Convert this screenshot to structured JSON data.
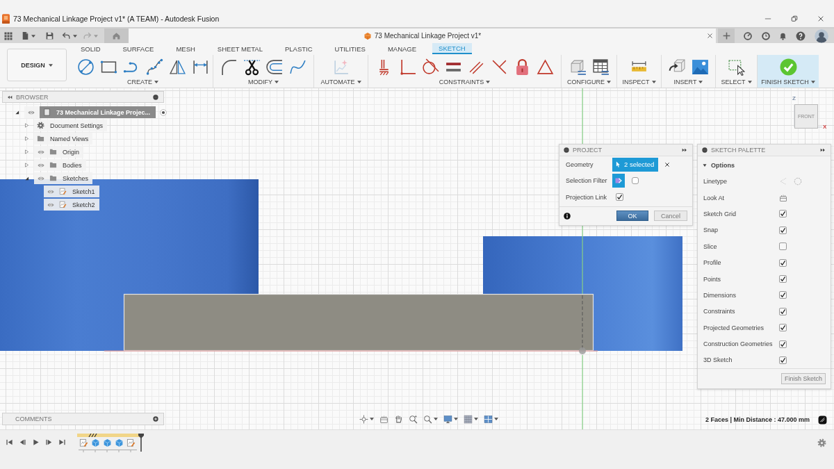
{
  "window": {
    "title": "73 Mechanical Linkage Project v1* (A TEAM) - Autodesk Fusion"
  },
  "quick_access": {
    "undo": {
      "disabled": false
    },
    "redo": {
      "disabled": true
    }
  },
  "document_tab": {
    "title": "73 Mechanical Linkage Project v1*"
  },
  "ribbon": {
    "workspace": "DESIGN",
    "tabs": [
      {
        "label": "SOLID",
        "selected": false
      },
      {
        "label": "SURFACE",
        "selected": false
      },
      {
        "label": "MESH",
        "selected": false
      },
      {
        "label": "SHEET METAL",
        "selected": false
      },
      {
        "label": "PLASTIC",
        "selected": false
      },
      {
        "label": "UTILITIES",
        "selected": false
      },
      {
        "label": "MANAGE",
        "selected": false
      },
      {
        "label": "SKETCH",
        "selected": true
      }
    ],
    "groups": [
      {
        "label": "CREATE",
        "highlighted": false
      },
      {
        "label": "MODIFY",
        "highlighted": false
      },
      {
        "label": "AUTOMATE",
        "highlighted": false
      },
      {
        "label": "CONSTRAINTS",
        "highlighted": false
      },
      {
        "label": "CONFIGURE",
        "highlighted": false
      },
      {
        "label": "INSPECT",
        "highlighted": false
      },
      {
        "label": "INSERT",
        "highlighted": false
      },
      {
        "label": "SELECT",
        "highlighted": false
      },
      {
        "label": "FINISH SKETCH",
        "highlighted": true
      }
    ]
  },
  "browser": {
    "title": "BROWSER",
    "tree": [
      {
        "label": "73 Mechanical Linkage Projec...",
        "kind": "document",
        "eye": true,
        "expanded": true,
        "children": [
          {
            "label": "Document Settings",
            "kind": "settings",
            "eye": false,
            "expanded": false
          },
          {
            "label": "Named Views",
            "kind": "folder",
            "eye": false,
            "expanded": false
          },
          {
            "label": "Origin",
            "kind": "folder",
            "eye": true,
            "expanded": false
          },
          {
            "label": "Bodies",
            "kind": "folder",
            "eye": true,
            "expanded": false
          },
          {
            "label": "Sketches",
            "kind": "folder",
            "eye": true,
            "expanded": true,
            "children": [
              {
                "label": "Sketch1",
                "kind": "sketch",
                "eye": true
              },
              {
                "label": "Sketch2",
                "kind": "sketch",
                "eye": true
              }
            ]
          }
        ]
      }
    ]
  },
  "view_cube": {
    "face": "FRONT",
    "axes": [
      "Z",
      "X"
    ]
  },
  "project_dialog": {
    "title": "PROJECT",
    "geometry": {
      "label": "Geometry",
      "value": "2 selected",
      "selected": true
    },
    "selection_filter": {
      "label": "Selection Filter",
      "options": [
        {
          "selected": true
        },
        {
          "selected": false
        }
      ]
    },
    "projection_link": {
      "label": "Projection Link",
      "checked": true
    },
    "buttons": [
      {
        "label": "OK",
        "kind": "primary"
      },
      {
        "label": "Cancel",
        "kind": "secondary"
      }
    ]
  },
  "sketch_palette": {
    "title": "SKETCH PALETTE",
    "section": {
      "label": "Options",
      "expanded": true
    },
    "options": [
      {
        "label": "Linetype",
        "kind": "linetype"
      },
      {
        "label": "Look At",
        "kind": "look_at"
      },
      {
        "label": "Sketch Grid",
        "kind": "checkbox",
        "checked": true
      },
      {
        "label": "Snap",
        "kind": "checkbox",
        "checked": true
      },
      {
        "label": "Slice",
        "kind": "checkbox",
        "checked": false
      },
      {
        "label": "Profile",
        "kind": "checkbox",
        "checked": true
      },
      {
        "label": "Points",
        "kind": "checkbox",
        "checked": true
      },
      {
        "label": "Dimensions",
        "kind": "checkbox",
        "checked": true
      },
      {
        "label": "Constraints",
        "kind": "checkbox",
        "checked": true
      },
      {
        "label": "Projected Geometries",
        "kind": "checkbox",
        "checked": true
      },
      {
        "label": "Construction Geometries",
        "kind": "checkbox",
        "checked": true
      },
      {
        "label": "3D Sketch",
        "kind": "checkbox",
        "checked": true
      }
    ],
    "button": "Finish Sketch"
  },
  "comments": {
    "title": "COMMENTS"
  },
  "status": "2 Faces | Min Distance : 47.000 mm",
  "timeline": [
    {
      "kind": "sketch"
    },
    {
      "kind": "extrude"
    },
    {
      "kind": "extrude"
    },
    {
      "kind": "extrude"
    },
    {
      "kind": "sketch"
    }
  ]
}
